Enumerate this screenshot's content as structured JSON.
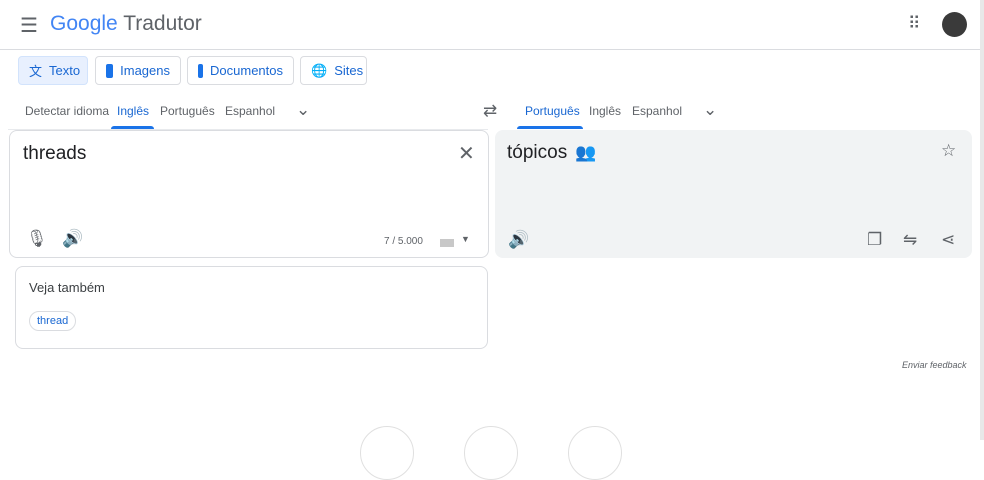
{
  "header": {
    "logo_google": "Google",
    "logo_product": "Tradutor"
  },
  "modes": [
    {
      "label": "Texto"
    },
    {
      "label": "Imagens"
    },
    {
      "label": "Documentos"
    },
    {
      "label": "Sites"
    }
  ],
  "source_langs": [
    "Detectar idioma",
    "Inglês",
    "Português",
    "Espanhol"
  ],
  "target_langs": [
    "Português",
    "Inglês",
    "Espanhol"
  ],
  "source": {
    "text": "threads",
    "char_count": "7 / 5.000"
  },
  "target": {
    "text": "tópicos"
  },
  "see_also": {
    "title": "Veja também",
    "chips": [
      "thread"
    ]
  },
  "feedback": "Enviar feedback"
}
